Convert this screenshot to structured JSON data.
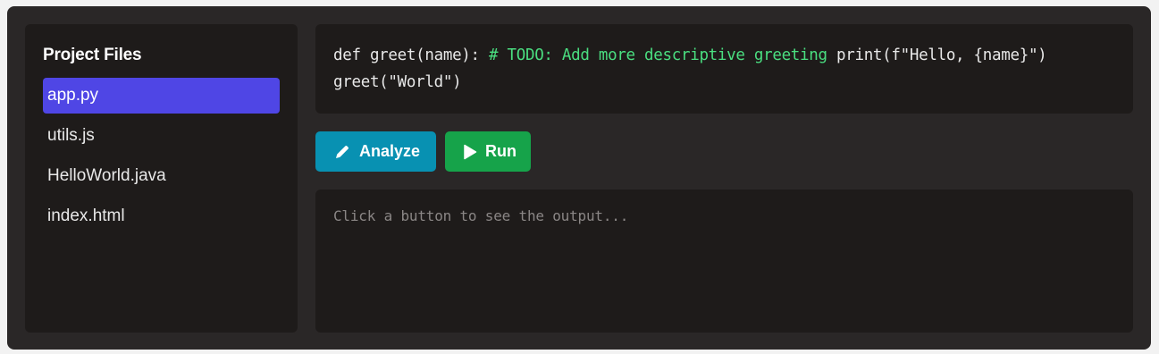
{
  "sidebar": {
    "title": "Project Files",
    "files": [
      {
        "name": "app.py",
        "active": true
      },
      {
        "name": "utils.js",
        "active": false
      },
      {
        "name": "HelloWorld.java",
        "active": false
      },
      {
        "name": "index.html",
        "active": false
      }
    ]
  },
  "code": {
    "line1_code": "def greet(name): ",
    "line1_comment": "# TODO: Add more descriptive greeting",
    "line1_rest": " print(f\"Hello, {name}\")",
    "line2": "greet(\"World\")"
  },
  "buttons": {
    "analyze_label": "Analyze",
    "analyze_icon": "pencil-icon",
    "run_label": "Run",
    "run_icon": "play-icon"
  },
  "output": {
    "placeholder": "Click a button to see the output..."
  },
  "colors": {
    "active_file": "#4f46e5",
    "analyze": "#0891b2",
    "run": "#16a34a",
    "comment": "#4ade80"
  }
}
